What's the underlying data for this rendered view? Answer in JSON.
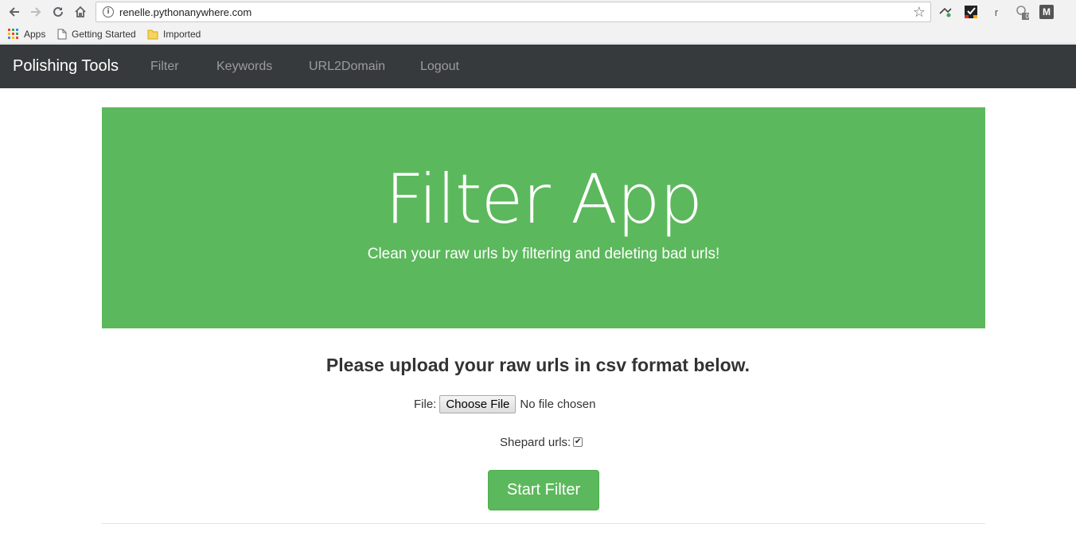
{
  "browser": {
    "url": "renelle.pythonanywhere.com",
    "icons": [
      "back-icon",
      "forward-icon",
      "reload-icon",
      "home-icon",
      "info-icon",
      "star-icon"
    ],
    "extensions": [
      "extension-icon-1",
      "extension-icon-2",
      "extension-icon-r",
      "extension-icon-4",
      "extension-icon-m"
    ],
    "extension_r_label": "r",
    "extension_m_label": "M",
    "extension_badge": "0",
    "bookmarks": [
      {
        "label": "Apps",
        "icon": "apps-grid-icon"
      },
      {
        "label": "Getting Started",
        "icon": "page-icon"
      },
      {
        "label": "Imported",
        "icon": "folder-icon"
      }
    ]
  },
  "navbar": {
    "brand": "Polishing Tools",
    "links": [
      "Filter",
      "Keywords",
      "URL2Domain",
      "Logout"
    ]
  },
  "jumbotron": {
    "title": "Filter App",
    "subtitle": "Clean your raw urls by filtering and deleting bad urls!"
  },
  "form": {
    "heading": "Please upload your raw urls in csv format below.",
    "file_label": "File:",
    "choose_button": "Choose File",
    "file_status": "No file chosen",
    "shepard_label": "Shepard urls:",
    "shepard_checked": true,
    "submit_label": "Start Filter"
  },
  "colors": {
    "navbar_bg": "#373a3c",
    "jumbotron_bg": "#5cb85c",
    "button_bg": "#5cb85c"
  }
}
